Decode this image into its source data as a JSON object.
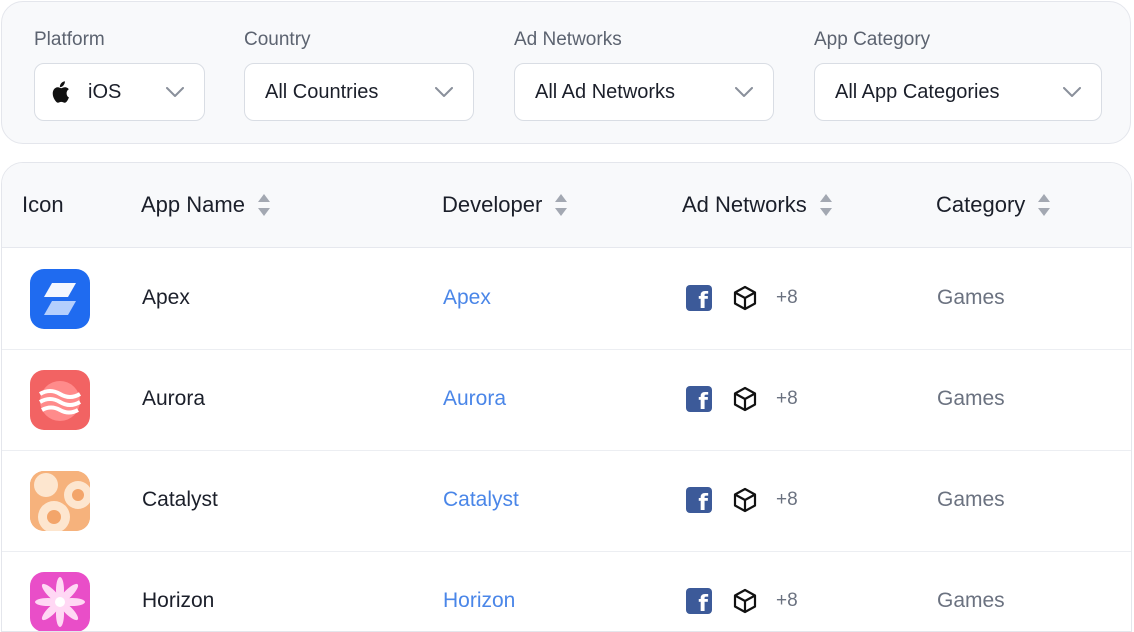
{
  "filters": [
    {
      "label": "Platform",
      "value": "iOS",
      "icon": "apple-icon"
    },
    {
      "label": "Country",
      "value": "All Countries"
    },
    {
      "label": "Ad Networks",
      "value": "All Ad Networks"
    },
    {
      "label": "App Category",
      "value": "All App Categories"
    }
  ],
  "table": {
    "headers": {
      "icon": "Icon",
      "app_name": "App Name",
      "developer": "Developer",
      "ad_networks": "Ad Networks",
      "category": "Category"
    },
    "rows": [
      {
        "app_name": "Apex",
        "developer": "Apex",
        "networks": [
          "facebook-icon",
          "unity-icon"
        ],
        "more": "+8",
        "category": "Games",
        "icon_color": "#1f6bf0"
      },
      {
        "app_name": "Aurora",
        "developer": "Aurora",
        "networks": [
          "facebook-icon",
          "unity-icon"
        ],
        "more": "+8",
        "category": "Games",
        "icon_color": "#f26363"
      },
      {
        "app_name": "Catalyst",
        "developer": "Catalyst",
        "networks": [
          "facebook-icon",
          "unity-icon"
        ],
        "more": "+8",
        "category": "Games",
        "icon_color": "#f3a56a"
      },
      {
        "app_name": "Horizon",
        "developer": "Horizon",
        "networks": [
          "facebook-icon",
          "unity-icon"
        ],
        "more": "+8",
        "category": "Games",
        "icon_color": "#e94ec8"
      }
    ]
  },
  "colors": {
    "link": "#4a86e8",
    "facebook": "#3c5a99",
    "muted": "#6b7280"
  }
}
